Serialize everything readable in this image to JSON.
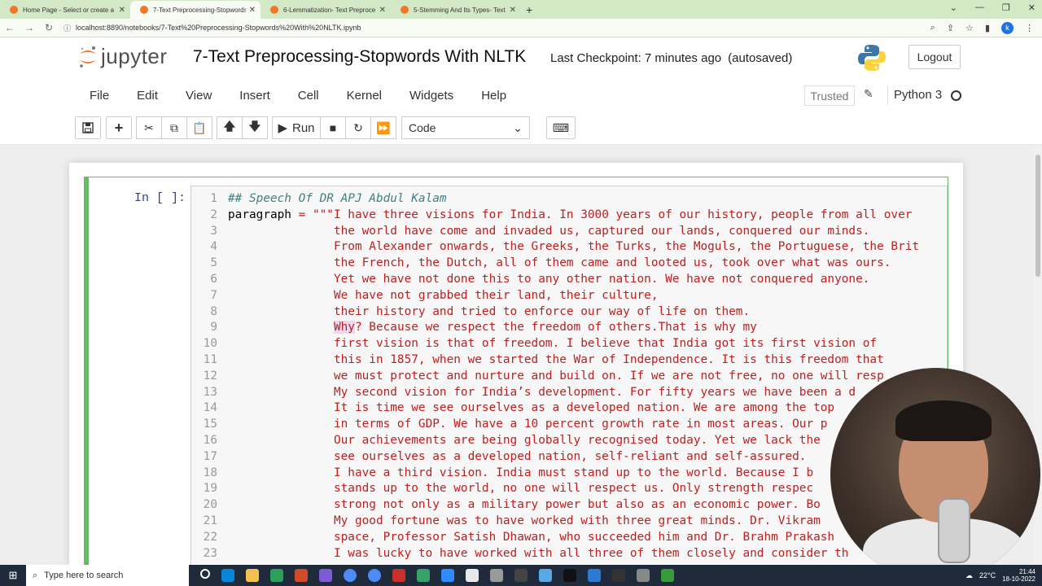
{
  "browser": {
    "tabs": [
      {
        "label": "Home Page - Select or create a n",
        "active": false
      },
      {
        "label": "7-Text Preprocessing-Stopwords",
        "active": true
      },
      {
        "label": "6-Lemmatization- Text Preproce",
        "active": false
      },
      {
        "label": "5-Stemming And Its Types- Text",
        "active": false
      }
    ],
    "new_tab": "+",
    "url": "localhost:8890/notebooks/7-Text%20Preprocessing-Stopwords%20With%20NLTK.ipynb",
    "profile_initial": "k"
  },
  "header": {
    "logo_text": "jupyter",
    "notebook_title": "7-Text Preprocessing-Stopwords With NLTK",
    "checkpoint": "Last Checkpoint: 7 minutes ago",
    "autosave": "(autosaved)",
    "logout_label": "Logout"
  },
  "menubar": {
    "items": [
      "File",
      "Edit",
      "View",
      "Insert",
      "Cell",
      "Kernel",
      "Widgets",
      "Help"
    ],
    "trusted_label": "Trusted",
    "kernel_name": "Python 3"
  },
  "toolbar": {
    "run_label": "Run",
    "cell_type": "Code"
  },
  "cell": {
    "prompt": "In [ ]:",
    "lines": [
      {
        "n": "1",
        "text": "## Speech Of DR APJ Abdul Kalam",
        "kind": "comment"
      },
      {
        "n": "2",
        "text": "paragraph = \"\"\"I have three visions for India. In 3000 years of our history, people from all over",
        "kind": "assign"
      },
      {
        "n": "3",
        "text": "               the world have come and invaded us, captured our lands, conquered our minds.",
        "kind": "str"
      },
      {
        "n": "4",
        "text": "               From Alexander onwards, the Greeks, the Turks, the Moguls, the Portuguese, the Brit",
        "kind": "str"
      },
      {
        "n": "5",
        "text": "               the French, the Dutch, all of them came and looted us, took over what was ours.",
        "kind": "str"
      },
      {
        "n": "6",
        "text": "               Yet we have not done this to any other nation. We have not conquered anyone.",
        "kind": "str"
      },
      {
        "n": "7",
        "text": "               We have not grabbed their land, their culture,",
        "kind": "str"
      },
      {
        "n": "8",
        "text": "               their history and tried to enforce our way of life on them.",
        "kind": "str"
      },
      {
        "n": "9",
        "text": "               Why? Because we respect the freedom of others.That is why my",
        "kind": "str"
      },
      {
        "n": "10",
        "text": "               first vision is that of freedom. I believe that India got its first vision of",
        "kind": "str"
      },
      {
        "n": "11",
        "text": "               this in 1857, when we started the War of Independence. It is this freedom that",
        "kind": "str"
      },
      {
        "n": "12",
        "text": "               we must protect and nurture and build on. If we are not free, no one will resp",
        "kind": "str"
      },
      {
        "n": "13",
        "text": "               My second vision for India’s development. For fifty years we have been a d",
        "kind": "str"
      },
      {
        "n": "14",
        "text": "               It is time we see ourselves as a developed nation. We are among the top",
        "kind": "str"
      },
      {
        "n": "15",
        "text": "               in terms of GDP. We have a 10 percent growth rate in most areas. Our p",
        "kind": "str"
      },
      {
        "n": "16",
        "text": "               Our achievements are being globally recognised today. Yet we lack the",
        "kind": "str"
      },
      {
        "n": "17",
        "text": "               see ourselves as a developed nation, self-reliant and self-assured.",
        "kind": "str"
      },
      {
        "n": "18",
        "text": "               I have a third vision. India must stand up to the world. Because I b",
        "kind": "str"
      },
      {
        "n": "19",
        "text": "               stands up to the world, no one will respect us. Only strength respec",
        "kind": "str"
      },
      {
        "n": "20",
        "text": "               strong not only as a military power but also as an economic power. Bo",
        "kind": "str"
      },
      {
        "n": "21",
        "text": "               My good fortune was to have worked with three great minds. Dr. Vikram",
        "kind": "str"
      },
      {
        "n": "22",
        "text": "               space, Professor Satish Dhawan, who succeeded him and Dr. Brahm Prakash",
        "kind": "str"
      },
      {
        "n": "23",
        "text": "               I was lucky to have worked with all three of them closely and consider th",
        "kind": "str"
      }
    ]
  },
  "taskbar": {
    "search_placeholder": "Type here to search",
    "temperature": "22°C",
    "time": "21:44",
    "date": "18-10-2022"
  },
  "colors": {
    "cell_border": "#66bb6a",
    "prompt": "#303f9f",
    "comment": "#408080",
    "string": "#ba2121"
  }
}
